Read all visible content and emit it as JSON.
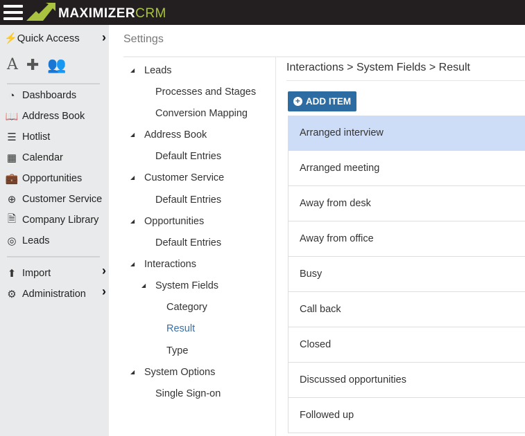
{
  "app": {
    "brand_main": "MAXIMIZER",
    "brand_accent": "CRM",
    "accent": "#a9c23f"
  },
  "sidebar": {
    "quick_access": "Quick Access",
    "items": [
      {
        "label": "Dashboards",
        "icon": "gauge-icon"
      },
      {
        "label": "Address Book",
        "icon": "book-icon"
      },
      {
        "label": "Hotlist",
        "icon": "list-icon"
      },
      {
        "label": "Calendar",
        "icon": "calendar-icon"
      },
      {
        "label": "Opportunities",
        "icon": "briefcase-icon"
      },
      {
        "label": "Customer Service",
        "icon": "lifebuoy-icon"
      },
      {
        "label": "Company Library",
        "icon": "document-icon"
      },
      {
        "label": "Leads",
        "icon": "target-icon"
      }
    ],
    "bottom": [
      {
        "label": "Import",
        "icon": "upload-icon"
      },
      {
        "label": "Administration",
        "icon": "gear-icon"
      }
    ]
  },
  "main": {
    "title": "Settings",
    "tree": [
      {
        "label": "Leads",
        "level": 0,
        "expanded": true
      },
      {
        "label": "Processes and Stages",
        "level": 1
      },
      {
        "label": "Conversion Mapping",
        "level": 1
      },
      {
        "label": "Address Book",
        "level": 0,
        "expanded": true
      },
      {
        "label": "Default Entries",
        "level": 1
      },
      {
        "label": "Customer Service",
        "level": 0,
        "expanded": true
      },
      {
        "label": "Default Entries",
        "level": 1
      },
      {
        "label": "Opportunities",
        "level": 0,
        "expanded": true
      },
      {
        "label": "Default Entries",
        "level": 1
      },
      {
        "label": "Interactions",
        "level": 0,
        "expanded": true
      },
      {
        "label": "System Fields",
        "level": 1,
        "expanded": true
      },
      {
        "label": "Category",
        "level": 2
      },
      {
        "label": "Result",
        "level": 2,
        "selected": true
      },
      {
        "label": "Type",
        "level": 2
      },
      {
        "label": "System Options",
        "level": 0,
        "expanded": true
      },
      {
        "label": "Single Sign-on",
        "level": 1
      }
    ],
    "breadcrumb": "Interactions > System Fields > Result",
    "add_item": "ADD ITEM",
    "items": [
      "Arranged interview",
      "Arranged meeting",
      "Away from desk",
      "Away from office",
      "Busy",
      "Call back",
      "Closed",
      "Discussed opportunities",
      "Followed up"
    ],
    "selected_item": "Arranged interview"
  }
}
